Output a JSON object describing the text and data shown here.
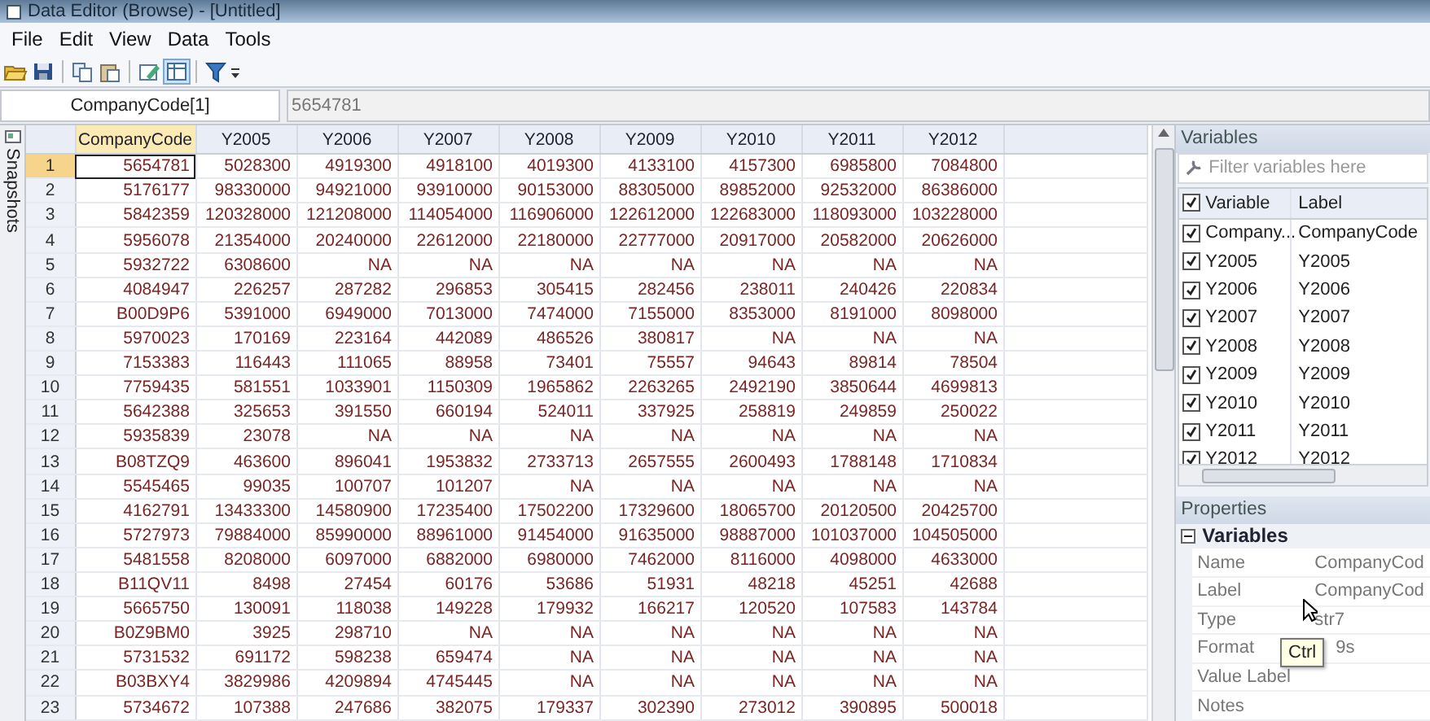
{
  "window": {
    "title": "Data Editor (Browse) - [Untitled]"
  },
  "menu": [
    "File",
    "Edit",
    "View",
    "Data",
    "Tools"
  ],
  "cell_bar": {
    "cell_name": "CompanyCode[1]",
    "value": "5654781"
  },
  "snapshots_tab": {
    "label": "Snapshots"
  },
  "table": {
    "columns": [
      {
        "label": "CompanyCode",
        "selected": true
      },
      {
        "label": "Y2005",
        "selected": false
      },
      {
        "label": "Y2006",
        "selected": false
      },
      {
        "label": "Y2007",
        "selected": false
      },
      {
        "label": "Y2008",
        "selected": false
      },
      {
        "label": "Y2009",
        "selected": false
      },
      {
        "label": "Y2010",
        "selected": false
      },
      {
        "label": "Y2011",
        "selected": false
      },
      {
        "label": "Y2012",
        "selected": false
      }
    ],
    "rows": [
      {
        "number": "1",
        "selected": true,
        "cells": [
          "5654781",
          "5028300",
          "4919300",
          "4918100",
          "4019300",
          "4133100",
          "4157300",
          "6985800",
          "7084800"
        ]
      },
      {
        "number": "2",
        "selected": false,
        "cells": [
          "5176177",
          "98330000",
          "94921000",
          "93910000",
          "90153000",
          "88305000",
          "89852000",
          "92532000",
          "86386000"
        ]
      },
      {
        "number": "3",
        "selected": false,
        "cells": [
          "5842359",
          "120328000",
          "121208000",
          "114054000",
          "116906000",
          "122612000",
          "122683000",
          "118093000",
          "103228000"
        ]
      },
      {
        "number": "4",
        "selected": false,
        "cells": [
          "5956078",
          "21354000",
          "20240000",
          "22612000",
          "22180000",
          "22777000",
          "20917000",
          "20582000",
          "20626000"
        ]
      },
      {
        "number": "5",
        "selected": false,
        "cells": [
          "5932722",
          "6308600",
          "NA",
          "NA",
          "NA",
          "NA",
          "NA",
          "NA",
          "NA"
        ]
      },
      {
        "number": "6",
        "selected": false,
        "cells": [
          "4084947",
          "226257",
          "287282",
          "296853",
          "305415",
          "282456",
          "238011",
          "240426",
          "220834"
        ]
      },
      {
        "number": "7",
        "selected": false,
        "cells": [
          "B00D9P6",
          "5391000",
          "6949000",
          "7013000",
          "7474000",
          "7155000",
          "8353000",
          "8191000",
          "8098000"
        ]
      },
      {
        "number": "8",
        "selected": false,
        "cells": [
          "5970023",
          "170169",
          "223164",
          "442089",
          "486526",
          "380817",
          "NA",
          "NA",
          "NA"
        ]
      },
      {
        "number": "9",
        "selected": false,
        "cells": [
          "7153383",
          "116443",
          "111065",
          "88958",
          "73401",
          "75557",
          "94643",
          "89814",
          "78504"
        ]
      },
      {
        "number": "10",
        "selected": false,
        "cells": [
          "7759435",
          "581551",
          "1033901",
          "1150309",
          "1965862",
          "2263265",
          "2492190",
          "3850644",
          "4699813"
        ]
      },
      {
        "number": "11",
        "selected": false,
        "cells": [
          "5642388",
          "325653",
          "391550",
          "660194",
          "524011",
          "337925",
          "258819",
          "249859",
          "250022"
        ]
      },
      {
        "number": "12",
        "selected": false,
        "cells": [
          "5935839",
          "23078",
          "NA",
          "NA",
          "NA",
          "NA",
          "NA",
          "NA",
          "NA"
        ]
      },
      {
        "number": "13",
        "selected": false,
        "cells": [
          "B08TZQ9",
          "463600",
          "896041",
          "1953832",
          "2733713",
          "2657555",
          "2600493",
          "1788148",
          "1710834"
        ]
      },
      {
        "number": "14",
        "selected": false,
        "cells": [
          "5545465",
          "99035",
          "100707",
          "101207",
          "NA",
          "NA",
          "NA",
          "NA",
          "NA"
        ]
      },
      {
        "number": "15",
        "selected": false,
        "cells": [
          "4162791",
          "13433300",
          "14580900",
          "17235400",
          "17502200",
          "17329600",
          "18065700",
          "20120500",
          "20425700"
        ]
      },
      {
        "number": "16",
        "selected": false,
        "cells": [
          "5727973",
          "79884000",
          "85990000",
          "88961000",
          "91454000",
          "91635000",
          "98887000",
          "101037000",
          "104505000"
        ]
      },
      {
        "number": "17",
        "selected": false,
        "cells": [
          "5481558",
          "8208000",
          "6097000",
          "6882000",
          "6980000",
          "7462000",
          "8116000",
          "4098000",
          "4633000"
        ]
      },
      {
        "number": "18",
        "selected": false,
        "cells": [
          "B11QV11",
          "8498",
          "27454",
          "60176",
          "53686",
          "51931",
          "48218",
          "45251",
          "42688"
        ]
      },
      {
        "number": "19",
        "selected": false,
        "cells": [
          "5665750",
          "130091",
          "118038",
          "149228",
          "179932",
          "166217",
          "120520",
          "107583",
          "143784"
        ]
      },
      {
        "number": "20",
        "selected": false,
        "cells": [
          "B0Z9BM0",
          "3925",
          "298710",
          "NA",
          "NA",
          "NA",
          "NA",
          "NA",
          "NA"
        ]
      },
      {
        "number": "21",
        "selected": false,
        "cells": [
          "5731532",
          "691172",
          "598238",
          "659474",
          "NA",
          "NA",
          "NA",
          "NA",
          "NA"
        ]
      },
      {
        "number": "22",
        "selected": false,
        "cells": [
          "B03BXY4",
          "3829986",
          "4209894",
          "4745445",
          "NA",
          "NA",
          "NA",
          "NA",
          "NA"
        ]
      },
      {
        "number": "23",
        "selected": false,
        "cells": [
          "5734672",
          "107388",
          "247686",
          "382075",
          "179337",
          "302390",
          "273012",
          "390895",
          "500018"
        ]
      }
    ]
  },
  "variables_panel": {
    "title": "Variables",
    "filter": {
      "placeholder": "Filter variables here"
    },
    "all_checked": true,
    "columns": [
      "Variable",
      "Label"
    ],
    "items": [
      {
        "name": "Company...",
        "label": "CompanyCode",
        "checked": true
      },
      {
        "name": "Y2005",
        "label": "Y2005",
        "checked": true
      },
      {
        "name": "Y2006",
        "label": "Y2006",
        "checked": true
      },
      {
        "name": "Y2007",
        "label": "Y2007",
        "checked": true
      },
      {
        "name": "Y2008",
        "label": "Y2008",
        "checked": true
      },
      {
        "name": "Y2009",
        "label": "Y2009",
        "checked": true
      },
      {
        "name": "Y2010",
        "label": "Y2010",
        "checked": true
      },
      {
        "name": "Y2011",
        "label": "Y2011",
        "checked": true
      },
      {
        "name": "Y2012",
        "label": "Y2012",
        "checked": true
      }
    ]
  },
  "properties_panel": {
    "title": "Properties",
    "group": {
      "label": "Variables",
      "expanded": true,
      "rows": [
        {
          "name": "Name",
          "value": "CompanyCod"
        },
        {
          "name": "Label",
          "value": "CompanyCod"
        },
        {
          "name": "Type",
          "value": "str7"
        },
        {
          "name": "Format",
          "value": "9s"
        },
        {
          "name": "Value Label"
        },
        {
          "name": "Notes"
        }
      ]
    }
  },
  "tooltip": {
    "text": "Ctrl"
  }
}
